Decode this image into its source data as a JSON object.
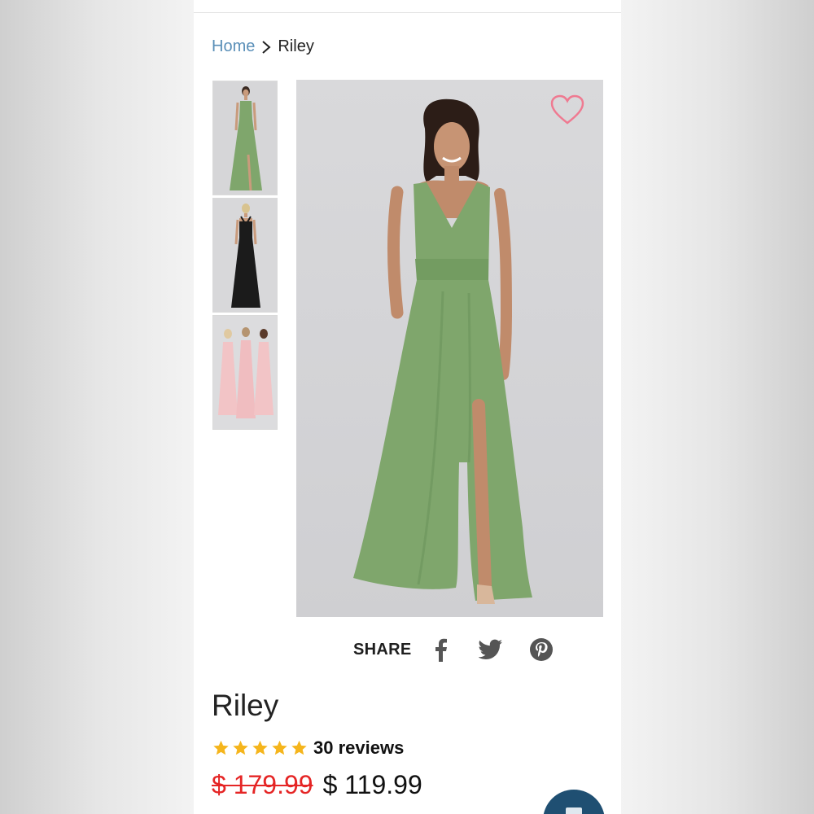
{
  "breadcrumb": {
    "home": "Home",
    "current": "Riley"
  },
  "product": {
    "name": "Riley",
    "rating_stars": 5,
    "reviews": "30 reviews",
    "price_original": "$ 179.99",
    "price_sale": "$ 119.99"
  },
  "share": {
    "label": "SHARE",
    "icons": [
      "facebook-icon",
      "twitter-icon",
      "pinterest-icon"
    ]
  },
  "thumbnails": [
    {
      "name": "thumbnail-green-front"
    },
    {
      "name": "thumbnail-black-back"
    },
    {
      "name": "thumbnail-pink-group"
    }
  ],
  "colors": {
    "link": "#5a8fb8",
    "dress_green": "#7fa66c",
    "wishlist_heart": "#ef7a91",
    "star": "#f5b51c",
    "sale_price": "#e52525",
    "chat_button": "#1f4f72"
  }
}
